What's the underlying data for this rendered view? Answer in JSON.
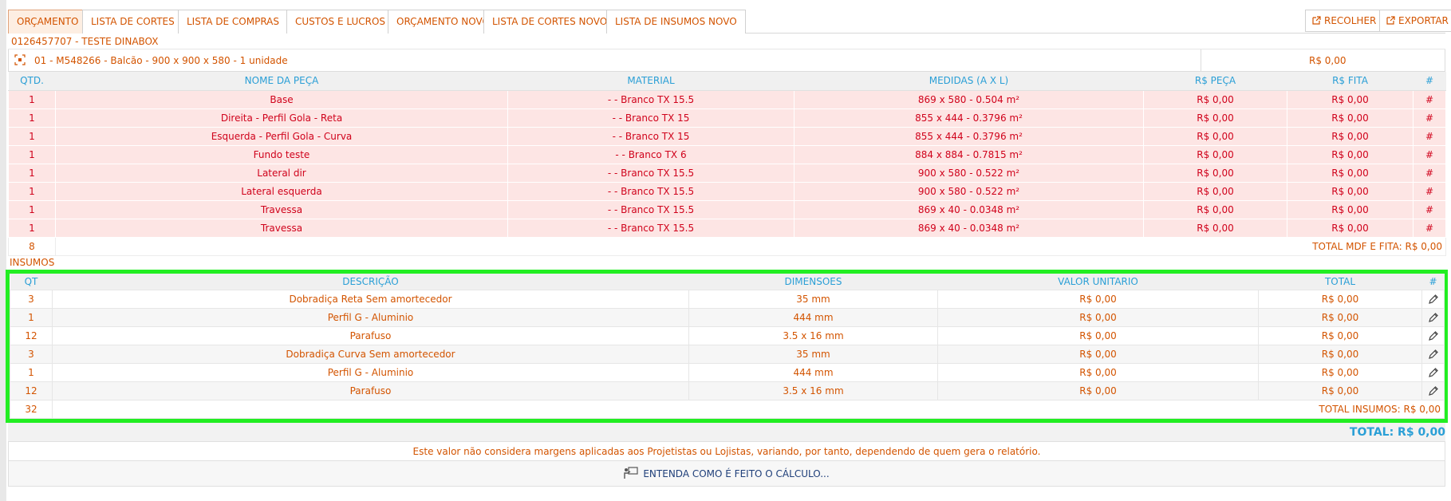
{
  "tabs": [
    {
      "label": "ORÇAMENTO",
      "active": true
    },
    {
      "label": "LISTA DE CORTES"
    },
    {
      "label": "LISTA DE COMPRAS"
    },
    {
      "label": "CUSTOS E LUCROS"
    },
    {
      "label": "ORÇAMENTO NOVO"
    },
    {
      "label": "LISTA DE CORTES NOVO"
    },
    {
      "label": "LISTA DE INSUMOS NOVO"
    }
  ],
  "actions": {
    "collapse": "RECOLHER",
    "export": "EXPORTAR"
  },
  "project": "0126457707 - TESTE DINABOX",
  "module": {
    "title": "01 - M548266 - Balcão - 900 x 900 x 580 - 1 unidade",
    "price": "R$ 0,00"
  },
  "pieces": {
    "headers": [
      "QTD.",
      "NOME DA PEÇA",
      "MATERIAL",
      "MEDIDAS (A X L)",
      "R$ PEÇA",
      "R$ FITA",
      "#"
    ],
    "rows": [
      [
        "1",
        "Base",
        "- - Branco TX 15.5",
        "869 x 580 - 0.504 m²",
        "R$ 0,00",
        "R$ 0,00",
        "#"
      ],
      [
        "1",
        "Direita - Perfil Gola - Reta",
        "- - Branco TX 15",
        "855 x 444 - 0.3796 m²",
        "R$ 0,00",
        "R$ 0,00",
        "#"
      ],
      [
        "1",
        "Esquerda - Perfil Gola - Curva",
        "- - Branco TX 15",
        "855 x 444 - 0.3796 m²",
        "R$ 0,00",
        "R$ 0,00",
        "#"
      ],
      [
        "1",
        "Fundo teste",
        "- - Branco TX 6",
        "884 x 884 - 0.7815 m²",
        "R$ 0,00",
        "R$ 0,00",
        "#"
      ],
      [
        "1",
        "Lateral dir",
        "- - Branco TX 15.5",
        "900 x 580 - 0.522 m²",
        "R$ 0,00",
        "R$ 0,00",
        "#"
      ],
      [
        "1",
        "Lateral esquerda",
        "- - Branco TX 15.5",
        "900 x 580 - 0.522 m²",
        "R$ 0,00",
        "R$ 0,00",
        "#"
      ],
      [
        "1",
        "Travessa",
        "- - Branco TX 15.5",
        "869 x 40 - 0.0348 m²",
        "R$ 0,00",
        "R$ 0,00",
        "#"
      ],
      [
        "1",
        "Travessa",
        "- - Branco TX 15.5",
        "869 x 40 - 0.0348 m²",
        "R$ 0,00",
        "R$ 0,00",
        "#"
      ]
    ],
    "total_qty": "8",
    "total_label": "TOTAL MDF E FITA: R$ 0,00"
  },
  "inputs_label": "INSUMOS",
  "inputs": {
    "headers": [
      "QT",
      "DESCRIÇÃO",
      "DIMENSOES",
      "VALOR UNITARIO",
      "TOTAL",
      "#"
    ],
    "rows": [
      [
        "3",
        "Dobradiça Reta Sem amortecedor",
        "35 mm",
        "R$ 0,00",
        "R$ 0,00"
      ],
      [
        "1",
        "Perfil G - Aluminio",
        "444 mm",
        "R$ 0,00",
        "R$ 0,00"
      ],
      [
        "12",
        "Parafuso",
        "3.5 x 16 mm",
        "R$ 0,00",
        "R$ 0,00"
      ],
      [
        "3",
        "Dobradiça Curva Sem amortecedor",
        "35 mm",
        "R$ 0,00",
        "R$ 0,00"
      ],
      [
        "1",
        "Perfil G - Aluminio",
        "444 mm",
        "R$ 0,00",
        "R$ 0,00"
      ],
      [
        "12",
        "Parafuso",
        "3.5 x 16 mm",
        "R$ 0,00",
        "R$ 0,00"
      ]
    ],
    "total_qty": "32",
    "total_label": "TOTAL INSUMOS: R$ 0,00"
  },
  "grand_total": "TOTAL: R$ 0,00",
  "note": "Este valor não considera margens aplicadas aos Projetistas ou Lojistas, variando, por tanto, dependendo de quem gera o relatório.",
  "calc_link": "ENTENDA COMO É FEITO O CÁLCULO...",
  "icons": {
    "collapse": "external-link-icon",
    "export": "external-link-icon",
    "module": "focus-icon",
    "edit": "pencil-icon",
    "calc": "presenter-icon"
  },
  "colors": {
    "tab_text": "#d35400",
    "header_text": "#2a9fd6",
    "piece_row_bg": "#fde5e4",
    "piece_text": "#d0021b",
    "highlight_border": "#22ee22"
  }
}
